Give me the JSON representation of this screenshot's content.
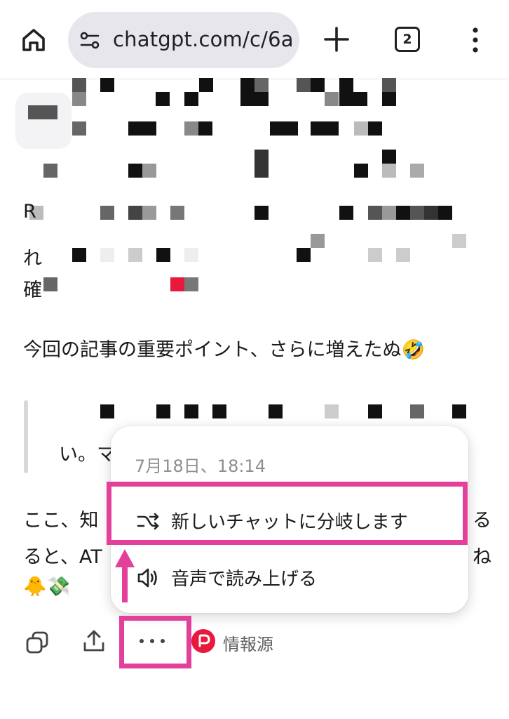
{
  "browser": {
    "url": "chatgpt.com/c/6a",
    "tab_count": "2"
  },
  "content": {
    "visible_fragments": {
      "line_r": "R",
      "line_re": "れ",
      "line_ka": "確"
    },
    "important_point_line": "今回の記事の重要ポイント、さらに増えたぬ🤣",
    "quote_fragment": "い。マ",
    "para_line1_start": "ここ、知",
    "para_line1_end": "る",
    "para_line2_start": "ると、AT",
    "para_line2_end": "ね",
    "emoji_line": "🐥💸"
  },
  "actions": {
    "source_label": "情報源"
  },
  "popup": {
    "date": "7月18日、18:14",
    "items": [
      {
        "label": "新しいチャットに分岐します",
        "icon": "branch-icon"
      },
      {
        "label": "音声で読み上げる",
        "icon": "speaker-icon"
      }
    ]
  },
  "colors": {
    "highlight": "#e2409a",
    "source_brand": "#e8193c",
    "urlbar_bg": "#e6e6ec"
  }
}
